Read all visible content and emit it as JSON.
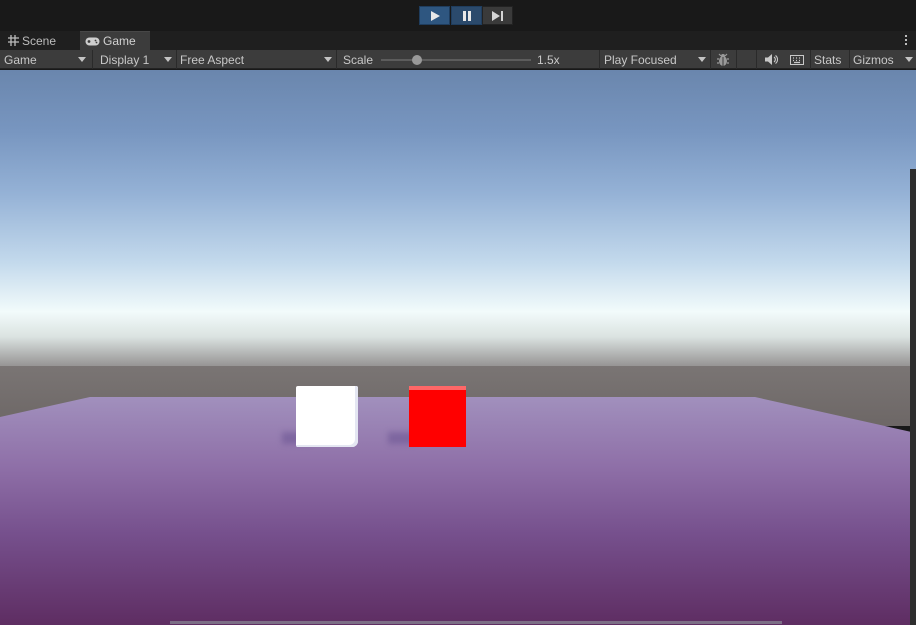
{
  "play_controls": {
    "play_icon": "play-icon",
    "pause_icon": "pause-icon",
    "step_icon": "step-icon"
  },
  "tabs": [
    {
      "label": "Scene",
      "icon": "grid-icon"
    },
    {
      "label": "Game",
      "icon": "gamepad-icon"
    }
  ],
  "toolbar": {
    "render_mode": "Game",
    "display": "Display 1",
    "aspect": "Free Aspect",
    "scale_label": "Scale",
    "scale_value": "1.5x",
    "scale_fraction": 0.24,
    "play_mode": "Play Focused",
    "stats": "Stats",
    "gizmos": "Gizmos"
  },
  "colors": {
    "active_play": "#2e5680",
    "cube_red": "#ff0000",
    "cube_white": "#ffffff",
    "floor_purple": "#8f70a8"
  }
}
